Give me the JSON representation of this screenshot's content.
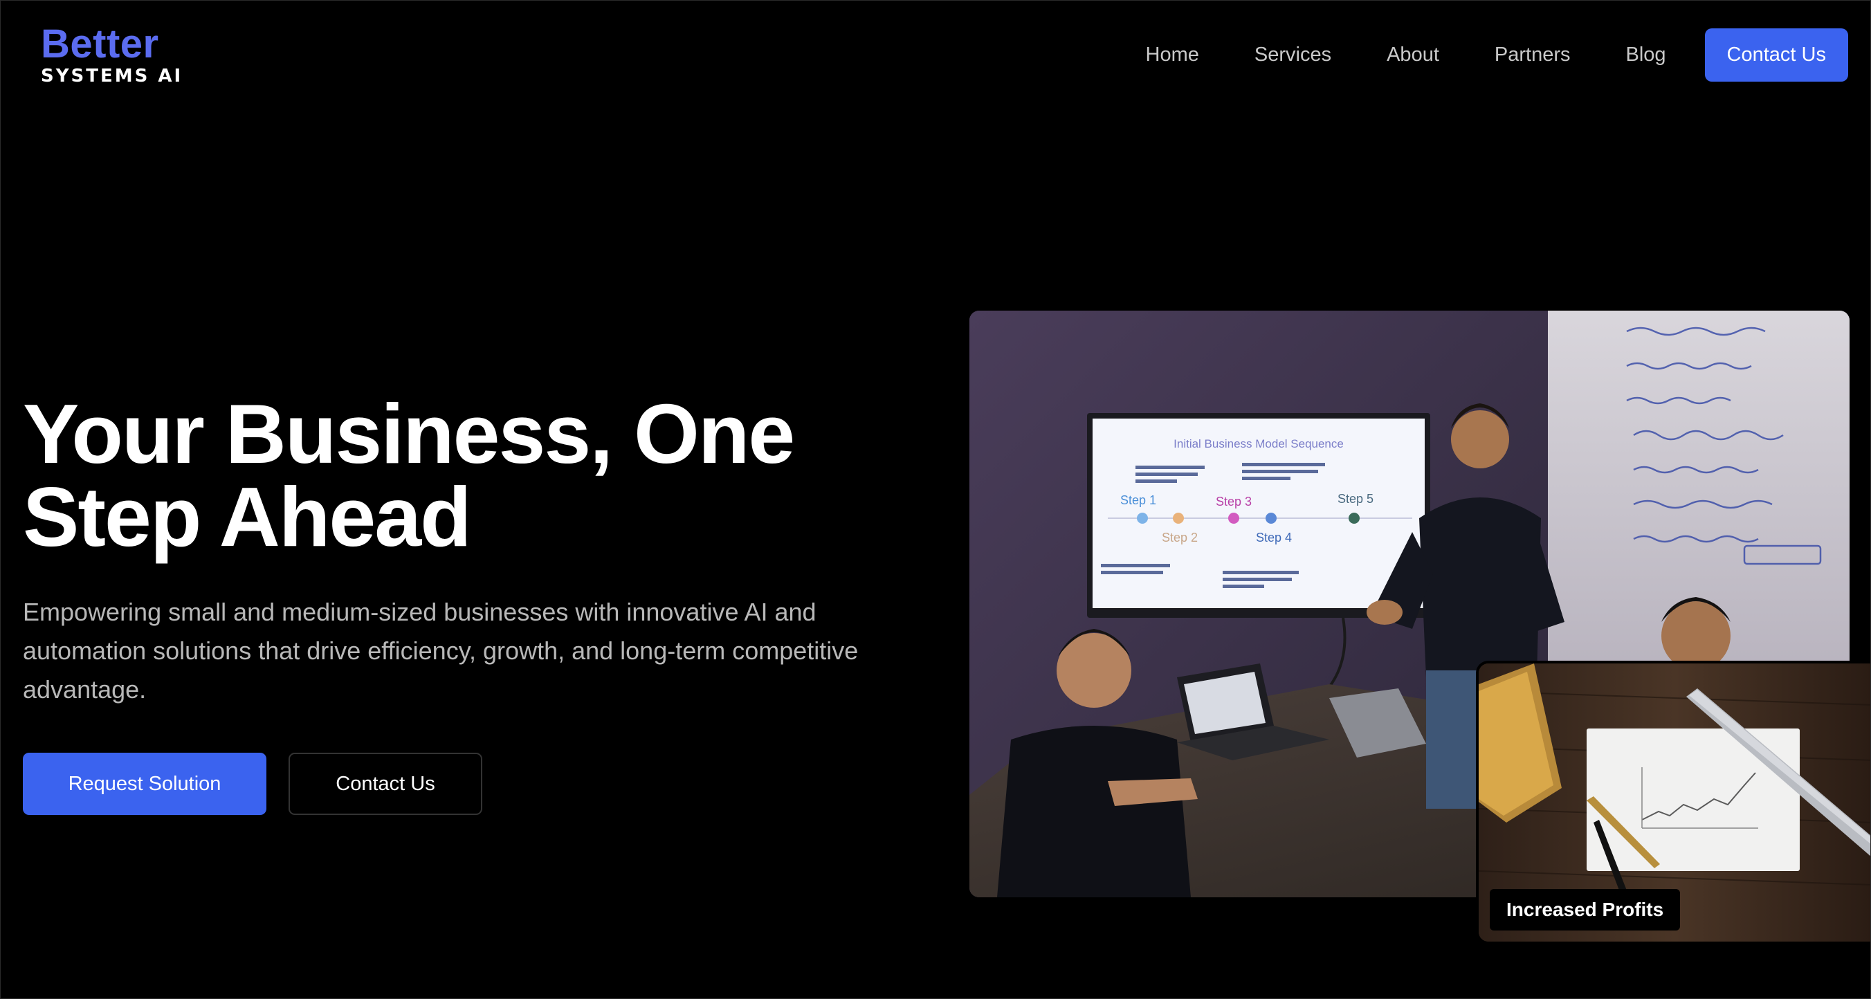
{
  "brand": {
    "name": "Better",
    "tagline": "SYSTEMS AI"
  },
  "nav": {
    "items": [
      {
        "label": "Home"
      },
      {
        "label": "Services"
      },
      {
        "label": "About"
      },
      {
        "label": "Partners"
      },
      {
        "label": "Blog"
      }
    ],
    "cta_label": "Contact Us"
  },
  "hero": {
    "title_line1": "Your Business, One",
    "title_line2": "Step Ahead",
    "subtitle": "Empowering small and medium-sized businesses with innovative AI and automation solutions that drive efficiency, growth, and long-term competitive advantage.",
    "primary_button": "Request Solution",
    "secondary_button": "Contact Us"
  },
  "images": {
    "main": {
      "screen_title": "Initial Business Model Sequence",
      "steps": [
        "Step 1",
        "Step 2",
        "Step 3",
        "Step 4",
        "Step 5"
      ]
    },
    "secondary": {
      "badge": "Increased Profits"
    }
  },
  "colors": {
    "accent": "#3b63ef",
    "logo": "#5b6cf0",
    "background": "#000000"
  }
}
